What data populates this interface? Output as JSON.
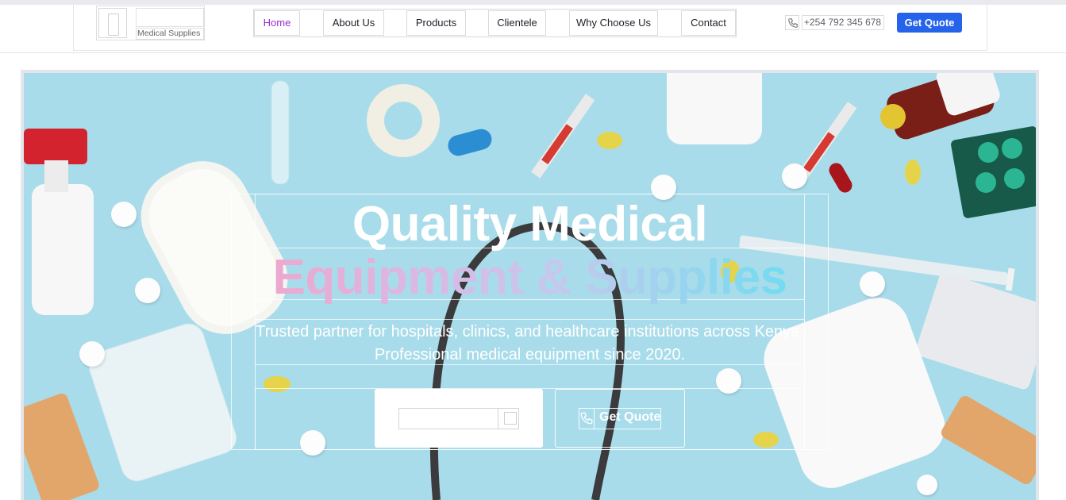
{
  "brand": {
    "subtitle": "Medical Supplies",
    "logo_icon": "medical-cross-icon"
  },
  "nav": {
    "items": [
      {
        "label": "Home",
        "active": true
      },
      {
        "label": "About Us",
        "active": false
      },
      {
        "label": "Products",
        "active": false
      },
      {
        "label": "Clientele",
        "active": false
      },
      {
        "label": "Why Choose Us",
        "active": false
      },
      {
        "label": "Contact",
        "active": false
      }
    ]
  },
  "header_contact": {
    "phone_icon": "phone-icon",
    "phone": "+254 792 345 678",
    "quote_label": "Get Quote"
  },
  "hero": {
    "title_line1": "Quality Medical",
    "title_line2": "Equipment & Supplies",
    "subtitle": "Trusted partner for hospitals, clinics, and healthcare institutions across Kenya. Professional medical equipment since 2020.",
    "cta_secondary_label": "Get Quote",
    "cta_secondary_icon": "phone-icon"
  },
  "colors": {
    "accent": "#2563eb",
    "active_nav": "#9b2bcf",
    "hero_bg": "#a8dbe9",
    "gradient_start": "#f2a4c9",
    "gradient_end": "#62dff0"
  }
}
